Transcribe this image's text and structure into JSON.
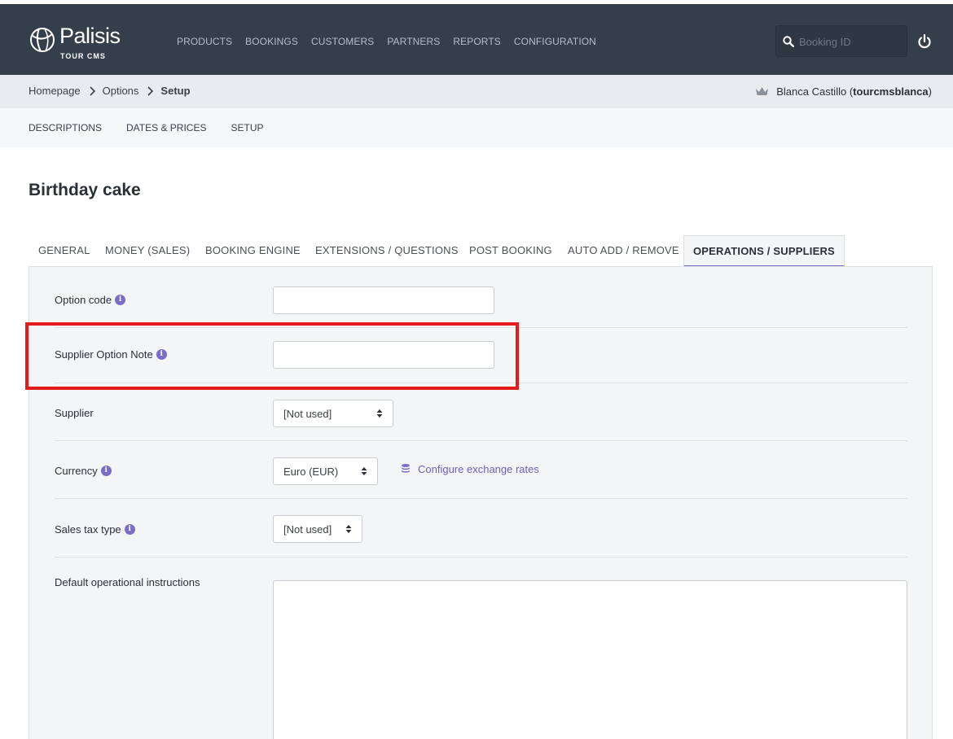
{
  "brand": {
    "name": "Palisis",
    "sub": "TOUR CMS"
  },
  "main_nav": [
    "PRODUCTS",
    "BOOKINGS",
    "CUSTOMERS",
    "PARTNERS",
    "REPORTS",
    "CONFIGURATION"
  ],
  "search": {
    "placeholder": "Booking ID"
  },
  "breadcrumb": {
    "items": [
      "Homepage",
      "Options",
      "Setup"
    ]
  },
  "user": {
    "name": "Blanca Castillo",
    "username": "tourcmsblanca"
  },
  "sub_nav": [
    "DESCRIPTIONS",
    "DATES & PRICES",
    "SETUP"
  ],
  "page_title": "Birthday cake",
  "tabs": [
    "GENERAL",
    "MONEY (SALES)",
    "BOOKING ENGINE",
    "EXTENSIONS / QUESTIONS",
    "POST BOOKING",
    "AUTO ADD / REMOVE",
    "OPERATIONS / SUPPLIERS"
  ],
  "active_tab": "OPERATIONS / SUPPLIERS",
  "form": {
    "option_code": {
      "label": "Option code",
      "value": ""
    },
    "supplier_option_note": {
      "label": "Supplier Option Note",
      "value": ""
    },
    "supplier": {
      "label": "Supplier",
      "value": "[Not used]"
    },
    "currency": {
      "label": "Currency",
      "value": "Euro (EUR)",
      "link": "Configure exchange rates"
    },
    "sales_tax_type": {
      "label": "Sales tax type",
      "value": "[Not used]"
    },
    "default_operational_instructions": {
      "label": "Default operational instructions",
      "value": ""
    }
  },
  "colors": {
    "topbar": "#353f4b",
    "accent": "#7b6cc7",
    "highlight": "#e31b1b"
  }
}
